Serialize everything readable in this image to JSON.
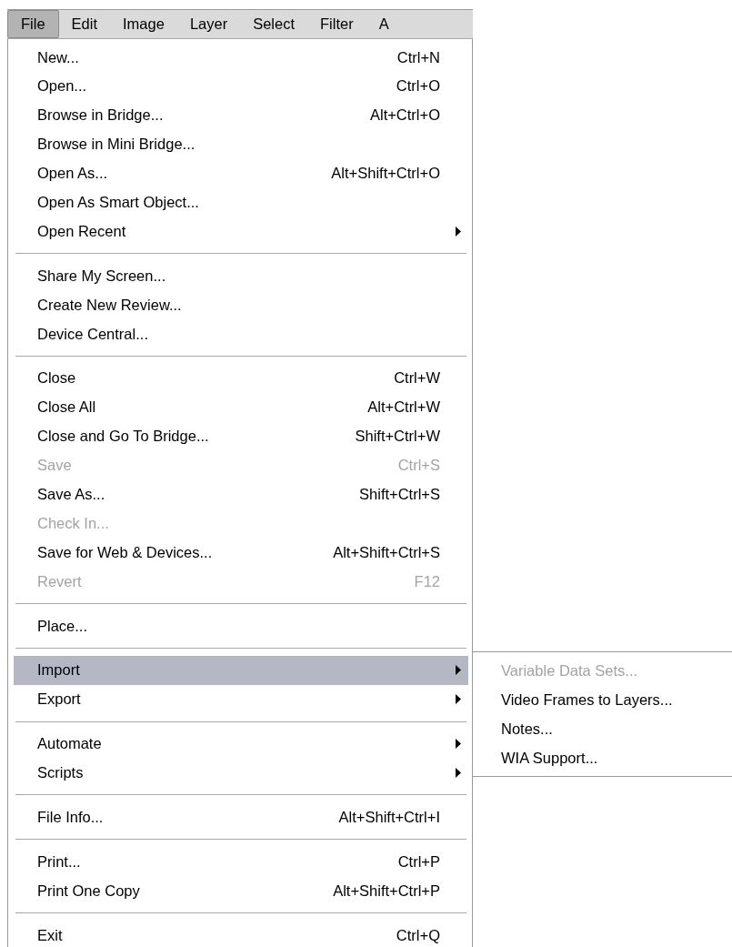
{
  "menubar": [
    {
      "label": "File",
      "selected": true
    },
    {
      "label": "Edit",
      "selected": false
    },
    {
      "label": "Image",
      "selected": false
    },
    {
      "label": "Layer",
      "selected": false
    },
    {
      "label": "Select",
      "selected": false
    },
    {
      "label": "Filter",
      "selected": false
    },
    {
      "label": "A",
      "selected": false
    }
  ],
  "menu": {
    "sections": [
      [
        {
          "label": "New...",
          "shortcut": "Ctrl+N",
          "disabled": false,
          "submenu": false,
          "selected": false
        },
        {
          "label": "Open...",
          "shortcut": "Ctrl+O",
          "disabled": false,
          "submenu": false,
          "selected": false
        },
        {
          "label": "Browse in Bridge...",
          "shortcut": "Alt+Ctrl+O",
          "disabled": false,
          "submenu": false,
          "selected": false
        },
        {
          "label": "Browse in Mini Bridge...",
          "disabled": false,
          "submenu": false,
          "selected": false
        },
        {
          "label": "Open As...",
          "shortcut": "Alt+Shift+Ctrl+O",
          "disabled": false,
          "submenu": false,
          "selected": false
        },
        {
          "label": "Open As Smart Object...",
          "disabled": false,
          "submenu": false,
          "selected": false
        },
        {
          "label": "Open Recent",
          "disabled": false,
          "submenu": true,
          "selected": false
        }
      ],
      [
        {
          "label": "Share My Screen...",
          "disabled": false,
          "submenu": false,
          "selected": false
        },
        {
          "label": "Create New Review...",
          "disabled": false,
          "submenu": false,
          "selected": false
        },
        {
          "label": "Device Central...",
          "disabled": false,
          "submenu": false,
          "selected": false
        }
      ],
      [
        {
          "label": "Close",
          "shortcut": "Ctrl+W",
          "disabled": false,
          "submenu": false,
          "selected": false
        },
        {
          "label": "Close All",
          "shortcut": "Alt+Ctrl+W",
          "disabled": false,
          "submenu": false,
          "selected": false
        },
        {
          "label": "Close and Go To Bridge...",
          "shortcut": "Shift+Ctrl+W",
          "disabled": false,
          "submenu": false,
          "selected": false
        },
        {
          "label": "Save",
          "shortcut": "Ctrl+S",
          "disabled": true,
          "submenu": false,
          "selected": false
        },
        {
          "label": "Save As...",
          "shortcut": "Shift+Ctrl+S",
          "disabled": false,
          "submenu": false,
          "selected": false
        },
        {
          "label": "Check In...",
          "disabled": true,
          "submenu": false,
          "selected": false
        },
        {
          "label": "Save for Web & Devices...",
          "shortcut": "Alt+Shift+Ctrl+S",
          "disabled": false,
          "submenu": false,
          "selected": false
        },
        {
          "label": "Revert",
          "shortcut": "F12",
          "disabled": true,
          "submenu": false,
          "selected": false
        }
      ],
      [
        {
          "label": "Place...",
          "disabled": false,
          "submenu": false,
          "selected": false
        }
      ],
      [
        {
          "label": "Import",
          "disabled": false,
          "submenu": true,
          "selected": true
        },
        {
          "label": "Export",
          "disabled": false,
          "submenu": true,
          "selected": false
        }
      ],
      [
        {
          "label": "Automate",
          "disabled": false,
          "submenu": true,
          "selected": false
        },
        {
          "label": "Scripts",
          "disabled": false,
          "submenu": true,
          "selected": false
        }
      ],
      [
        {
          "label": "File Info...",
          "shortcut": "Alt+Shift+Ctrl+I",
          "disabled": false,
          "submenu": false,
          "selected": false
        }
      ],
      [
        {
          "label": "Print...",
          "shortcut": "Ctrl+P",
          "disabled": false,
          "submenu": false,
          "selected": false
        },
        {
          "label": "Print One Copy",
          "shortcut": "Alt+Shift+Ctrl+P",
          "disabled": false,
          "submenu": false,
          "selected": false
        }
      ],
      [
        {
          "label": "Exit",
          "shortcut": "Ctrl+Q",
          "disabled": false,
          "submenu": false,
          "selected": false
        }
      ]
    ]
  },
  "submenu": {
    "items": [
      {
        "label": "Variable Data Sets...",
        "disabled": true
      },
      {
        "label": "Video Frames to Layers...",
        "disabled": false
      },
      {
        "label": "Notes...",
        "disabled": false
      },
      {
        "label": "WIA Support...",
        "disabled": false
      }
    ]
  }
}
